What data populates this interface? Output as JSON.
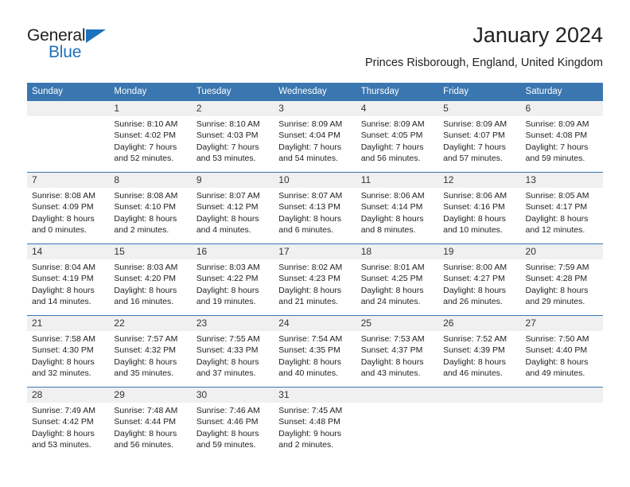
{
  "brand": {
    "name_part1": "General",
    "name_part2": "Blue",
    "accent_color": "#1c72bd"
  },
  "header": {
    "title": "January 2024",
    "subtitle": "Princes Risborough, England, United Kingdom"
  },
  "theme": {
    "header_blue": "#3a76af",
    "daynum_gray": "#f0f0f0"
  },
  "calendar": {
    "weekday_headers": [
      "Sunday",
      "Monday",
      "Tuesday",
      "Wednesday",
      "Thursday",
      "Friday",
      "Saturday"
    ],
    "weeks": [
      [
        {
          "day": "",
          "sunrise": "",
          "sunset": "",
          "daylight_line1": "",
          "daylight_line2": ""
        },
        {
          "day": "1",
          "sunrise": "Sunrise: 8:10 AM",
          "sunset": "Sunset: 4:02 PM",
          "daylight_line1": "Daylight: 7 hours",
          "daylight_line2": "and 52 minutes."
        },
        {
          "day": "2",
          "sunrise": "Sunrise: 8:10 AM",
          "sunset": "Sunset: 4:03 PM",
          "daylight_line1": "Daylight: 7 hours",
          "daylight_line2": "and 53 minutes."
        },
        {
          "day": "3",
          "sunrise": "Sunrise: 8:09 AM",
          "sunset": "Sunset: 4:04 PM",
          "daylight_line1": "Daylight: 7 hours",
          "daylight_line2": "and 54 minutes."
        },
        {
          "day": "4",
          "sunrise": "Sunrise: 8:09 AM",
          "sunset": "Sunset: 4:05 PM",
          "daylight_line1": "Daylight: 7 hours",
          "daylight_line2": "and 56 minutes."
        },
        {
          "day": "5",
          "sunrise": "Sunrise: 8:09 AM",
          "sunset": "Sunset: 4:07 PM",
          "daylight_line1": "Daylight: 7 hours",
          "daylight_line2": "and 57 minutes."
        },
        {
          "day": "6",
          "sunrise": "Sunrise: 8:09 AM",
          "sunset": "Sunset: 4:08 PM",
          "daylight_line1": "Daylight: 7 hours",
          "daylight_line2": "and 59 minutes."
        }
      ],
      [
        {
          "day": "7",
          "sunrise": "Sunrise: 8:08 AM",
          "sunset": "Sunset: 4:09 PM",
          "daylight_line1": "Daylight: 8 hours",
          "daylight_line2": "and 0 minutes."
        },
        {
          "day": "8",
          "sunrise": "Sunrise: 8:08 AM",
          "sunset": "Sunset: 4:10 PM",
          "daylight_line1": "Daylight: 8 hours",
          "daylight_line2": "and 2 minutes."
        },
        {
          "day": "9",
          "sunrise": "Sunrise: 8:07 AM",
          "sunset": "Sunset: 4:12 PM",
          "daylight_line1": "Daylight: 8 hours",
          "daylight_line2": "and 4 minutes."
        },
        {
          "day": "10",
          "sunrise": "Sunrise: 8:07 AM",
          "sunset": "Sunset: 4:13 PM",
          "daylight_line1": "Daylight: 8 hours",
          "daylight_line2": "and 6 minutes."
        },
        {
          "day": "11",
          "sunrise": "Sunrise: 8:06 AM",
          "sunset": "Sunset: 4:14 PM",
          "daylight_line1": "Daylight: 8 hours",
          "daylight_line2": "and 8 minutes."
        },
        {
          "day": "12",
          "sunrise": "Sunrise: 8:06 AM",
          "sunset": "Sunset: 4:16 PM",
          "daylight_line1": "Daylight: 8 hours",
          "daylight_line2": "and 10 minutes."
        },
        {
          "day": "13",
          "sunrise": "Sunrise: 8:05 AM",
          "sunset": "Sunset: 4:17 PM",
          "daylight_line1": "Daylight: 8 hours",
          "daylight_line2": "and 12 minutes."
        }
      ],
      [
        {
          "day": "14",
          "sunrise": "Sunrise: 8:04 AM",
          "sunset": "Sunset: 4:19 PM",
          "daylight_line1": "Daylight: 8 hours",
          "daylight_line2": "and 14 minutes."
        },
        {
          "day": "15",
          "sunrise": "Sunrise: 8:03 AM",
          "sunset": "Sunset: 4:20 PM",
          "daylight_line1": "Daylight: 8 hours",
          "daylight_line2": "and 16 minutes."
        },
        {
          "day": "16",
          "sunrise": "Sunrise: 8:03 AM",
          "sunset": "Sunset: 4:22 PM",
          "daylight_line1": "Daylight: 8 hours",
          "daylight_line2": "and 19 minutes."
        },
        {
          "day": "17",
          "sunrise": "Sunrise: 8:02 AM",
          "sunset": "Sunset: 4:23 PM",
          "daylight_line1": "Daylight: 8 hours",
          "daylight_line2": "and 21 minutes."
        },
        {
          "day": "18",
          "sunrise": "Sunrise: 8:01 AM",
          "sunset": "Sunset: 4:25 PM",
          "daylight_line1": "Daylight: 8 hours",
          "daylight_line2": "and 24 minutes."
        },
        {
          "day": "19",
          "sunrise": "Sunrise: 8:00 AM",
          "sunset": "Sunset: 4:27 PM",
          "daylight_line1": "Daylight: 8 hours",
          "daylight_line2": "and 26 minutes."
        },
        {
          "day": "20",
          "sunrise": "Sunrise: 7:59 AM",
          "sunset": "Sunset: 4:28 PM",
          "daylight_line1": "Daylight: 8 hours",
          "daylight_line2": "and 29 minutes."
        }
      ],
      [
        {
          "day": "21",
          "sunrise": "Sunrise: 7:58 AM",
          "sunset": "Sunset: 4:30 PM",
          "daylight_line1": "Daylight: 8 hours",
          "daylight_line2": "and 32 minutes."
        },
        {
          "day": "22",
          "sunrise": "Sunrise: 7:57 AM",
          "sunset": "Sunset: 4:32 PM",
          "daylight_line1": "Daylight: 8 hours",
          "daylight_line2": "and 35 minutes."
        },
        {
          "day": "23",
          "sunrise": "Sunrise: 7:55 AM",
          "sunset": "Sunset: 4:33 PM",
          "daylight_line1": "Daylight: 8 hours",
          "daylight_line2": "and 37 minutes."
        },
        {
          "day": "24",
          "sunrise": "Sunrise: 7:54 AM",
          "sunset": "Sunset: 4:35 PM",
          "daylight_line1": "Daylight: 8 hours",
          "daylight_line2": "and 40 minutes."
        },
        {
          "day": "25",
          "sunrise": "Sunrise: 7:53 AM",
          "sunset": "Sunset: 4:37 PM",
          "daylight_line1": "Daylight: 8 hours",
          "daylight_line2": "and 43 minutes."
        },
        {
          "day": "26",
          "sunrise": "Sunrise: 7:52 AM",
          "sunset": "Sunset: 4:39 PM",
          "daylight_line1": "Daylight: 8 hours",
          "daylight_line2": "and 46 minutes."
        },
        {
          "day": "27",
          "sunrise": "Sunrise: 7:50 AM",
          "sunset": "Sunset: 4:40 PM",
          "daylight_line1": "Daylight: 8 hours",
          "daylight_line2": "and 49 minutes."
        }
      ],
      [
        {
          "day": "28",
          "sunrise": "Sunrise: 7:49 AM",
          "sunset": "Sunset: 4:42 PM",
          "daylight_line1": "Daylight: 8 hours",
          "daylight_line2": "and 53 minutes."
        },
        {
          "day": "29",
          "sunrise": "Sunrise: 7:48 AM",
          "sunset": "Sunset: 4:44 PM",
          "daylight_line1": "Daylight: 8 hours",
          "daylight_line2": "and 56 minutes."
        },
        {
          "day": "30",
          "sunrise": "Sunrise: 7:46 AM",
          "sunset": "Sunset: 4:46 PM",
          "daylight_line1": "Daylight: 8 hours",
          "daylight_line2": "and 59 minutes."
        },
        {
          "day": "31",
          "sunrise": "Sunrise: 7:45 AM",
          "sunset": "Sunset: 4:48 PM",
          "daylight_line1": "Daylight: 9 hours",
          "daylight_line2": "and 2 minutes."
        },
        {
          "day": "",
          "sunrise": "",
          "sunset": "",
          "daylight_line1": "",
          "daylight_line2": ""
        },
        {
          "day": "",
          "sunrise": "",
          "sunset": "",
          "daylight_line1": "",
          "daylight_line2": ""
        },
        {
          "day": "",
          "sunrise": "",
          "sunset": "",
          "daylight_line1": "",
          "daylight_line2": ""
        }
      ]
    ]
  }
}
